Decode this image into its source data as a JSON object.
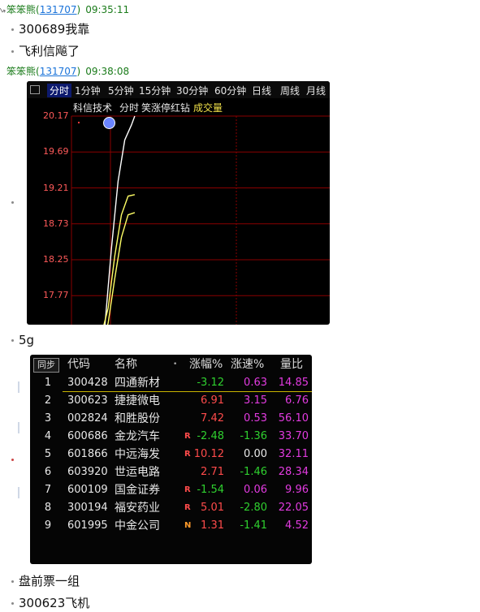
{
  "messages": [
    {
      "user": "笨笨熊",
      "uid": "131707",
      "time": "09:35:11",
      "lines": [
        "300689我靠",
        "飞利信飚了"
      ]
    },
    {
      "user": "笨笨熊",
      "uid": "131707",
      "time": "09:38:08",
      "lines": [
        "5g"
      ]
    }
  ],
  "tail_lines": [
    "盘前票一组",
    "300623飞机"
  ],
  "chart_widget": {
    "tabs": [
      "分时",
      "1分钟",
      "5分钟",
      "15分钟",
      "30分钟",
      "60分钟",
      "日线",
      "周线",
      "月线"
    ],
    "active_tab": "分时",
    "stock_name": "科信技术",
    "mode_label": "分时",
    "indicator_label": "笑涨停红钻",
    "volume_label": "成交量",
    "colors": {
      "price": "#ffffff",
      "avg": "#ffff66",
      "grid": "#8a0000",
      "axis_text": "#ff5a5a"
    }
  },
  "chart_data": {
    "type": "line",
    "ylim": [
      16.33,
      20.17
    ],
    "yticks": [
      "20.17",
      "19.69",
      "19.21",
      "18.73",
      "18.25",
      "17.77",
      "17.29",
      "16.81",
      "16.33"
    ],
    "series": [
      {
        "x": [
          0,
          2,
          5,
          8,
          10,
          12,
          14,
          16,
          18,
          19
        ],
        "values": [
          16.95,
          17.1,
          17.3,
          17.3,
          17.35,
          18.4,
          19.3,
          19.85,
          20.05,
          20.17
        ]
      },
      {
        "x": [
          0,
          3,
          6,
          9,
          11,
          13,
          15,
          17,
          19
        ],
        "values": [
          16.95,
          17.05,
          17.2,
          17.25,
          17.6,
          18.3,
          18.85,
          19.1,
          19.12
        ]
      },
      {
        "x": [
          0,
          3,
          6,
          9,
          11,
          13,
          15,
          17,
          19
        ],
        "values": [
          16.95,
          17.0,
          17.1,
          17.15,
          17.4,
          18.0,
          18.55,
          18.85,
          18.88
        ]
      }
    ]
  },
  "rank_table": {
    "sync_label": "同步",
    "headers": {
      "code": "代码",
      "name": "名称",
      "chg": "涨幅%",
      "speed": "涨速%",
      "vol_ratio": "量比"
    },
    "rows": [
      {
        "idx": "1",
        "code": "300428",
        "name": "四通新材",
        "flag": "",
        "chg": "-3.12",
        "speed": "0.63",
        "vr": "14.85"
      },
      {
        "idx": "2",
        "code": "300623",
        "name": "捷捷微电",
        "flag": "",
        "chg": "6.91",
        "speed": "3.15",
        "vr": "6.76"
      },
      {
        "idx": "3",
        "code": "002824",
        "name": "和胜股份",
        "flag": "",
        "chg": "7.42",
        "speed": "0.53",
        "vr": "56.10"
      },
      {
        "idx": "4",
        "code": "600686",
        "name": "金龙汽车",
        "flag": "R",
        "chg": "-2.48",
        "speed": "-1.36",
        "vr": "33.70"
      },
      {
        "idx": "5",
        "code": "601866",
        "name": "中远海发",
        "flag": "R",
        "chg": "10.12",
        "speed": "0.00",
        "vr": "32.11"
      },
      {
        "idx": "6",
        "code": "603920",
        "name": "世运电路",
        "flag": "",
        "chg": "2.71",
        "speed": "-1.46",
        "vr": "28.34"
      },
      {
        "idx": "7",
        "code": "600109",
        "name": "国金证券",
        "flag": "R",
        "chg": "-1.54",
        "speed": "0.06",
        "vr": "9.96"
      },
      {
        "idx": "8",
        "code": "300194",
        "name": "福安药业",
        "flag": "R",
        "chg": "5.01",
        "speed": "-2.80",
        "vr": "22.05"
      },
      {
        "idx": "9",
        "code": "601995",
        "name": "中金公司",
        "flag": "N",
        "chg": "1.31",
        "speed": "-1.41",
        "vr": "4.52"
      }
    ],
    "colors": {
      "up": "#ff4b4b",
      "down": "#2fd12f",
      "flat": "#e8e8e8",
      "spd_up": "#e23be0",
      "spd_down": "#2fd12f",
      "flag_r": "#ff4b4b",
      "flag_n": "#ff9a2a"
    }
  }
}
